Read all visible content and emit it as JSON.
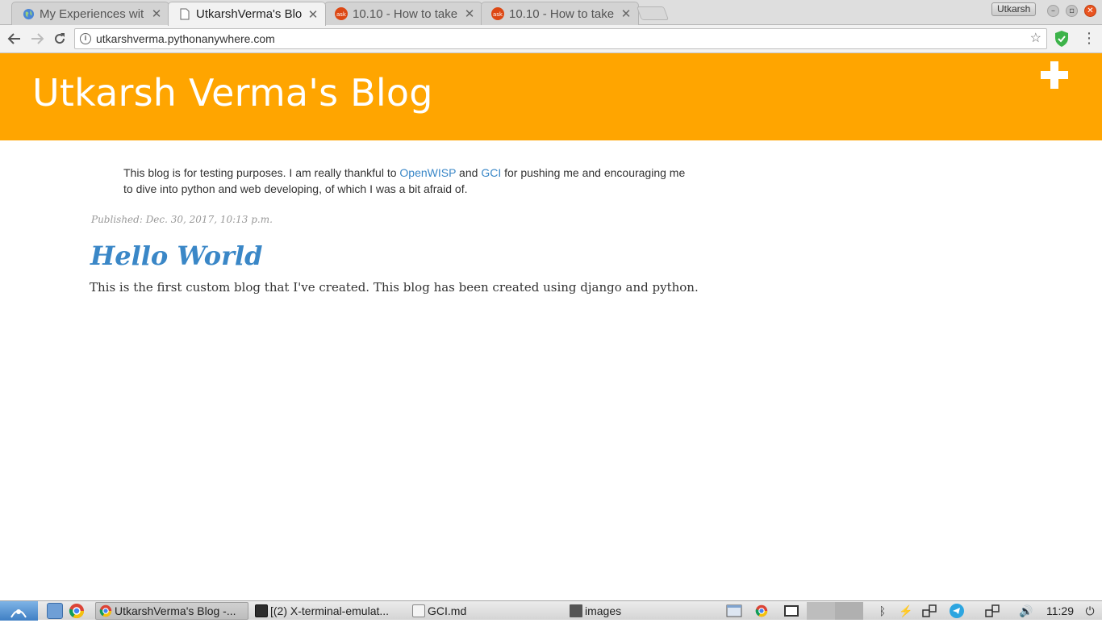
{
  "browser": {
    "tabs": [
      {
        "title": "My Experiences wit",
        "icon": "globe-icon",
        "active": false
      },
      {
        "title": "UtkarshVerma's Blo",
        "icon": "page-icon",
        "active": true
      },
      {
        "title": "10.10 - How to take",
        "icon": "askubuntu-icon",
        "active": false
      },
      {
        "title": "10.10 - How to take",
        "icon": "askubuntu-icon",
        "active": false
      }
    ],
    "profile_name": "Utkarsh",
    "url": "utkarshverma.pythonanywhere.com",
    "accent_color": "#ffa500"
  },
  "page": {
    "blog_title": "Utkarsh Verma's Blog",
    "intro": {
      "before": "This blog is for testing purposes. I am really thankful to ",
      "link1": "OpenWISP",
      "middle": " and ",
      "link2": "GCI",
      "after": " for pushing me and encouraging me to dive into python and web developing, of which I was a bit afraid of."
    },
    "posts": [
      {
        "published": "Published: Dec. 30, 2017, 10:13 p.m.",
        "title": "Hello World",
        "body": "This is the first custom blog that I've created. This blog has been created using django and python."
      }
    ]
  },
  "taskbar": {
    "windows": [
      {
        "label": "UtkarshVerma's Blog -...",
        "icon": "chrome-icon",
        "active": true
      },
      {
        "label": "[(2) X-terminal-emulat...",
        "icon": "terminal-icon",
        "active": false
      },
      {
        "label": "GCI.md",
        "icon": "text-file-icon",
        "active": false
      },
      {
        "label": "images",
        "icon": "folder-icon",
        "active": false
      }
    ],
    "clock": "11:29"
  }
}
